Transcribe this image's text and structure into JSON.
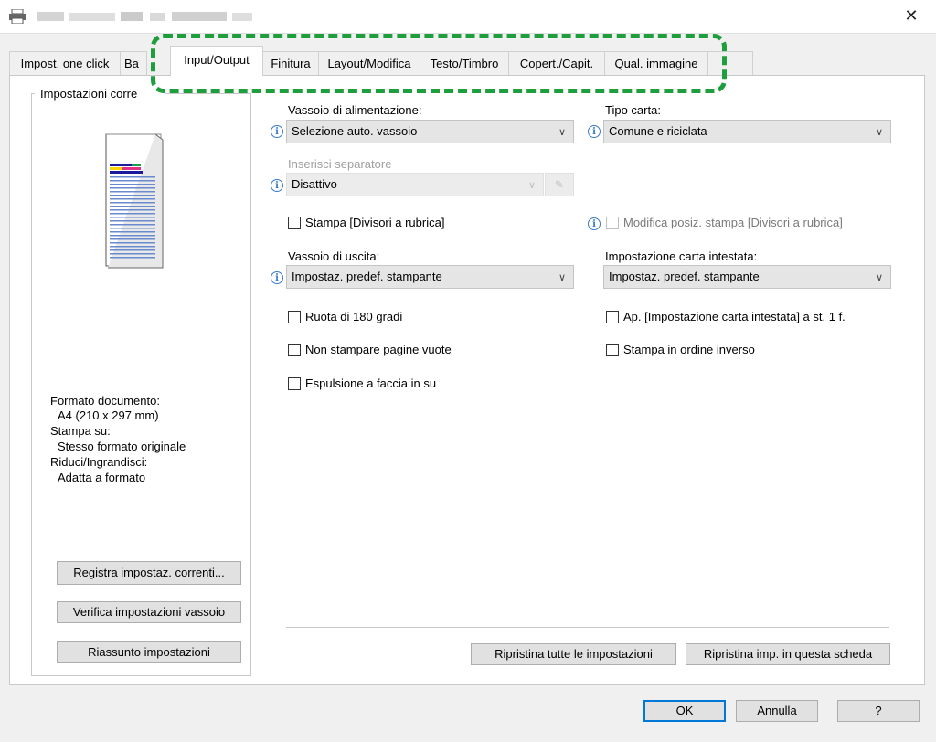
{
  "window": {
    "close_glyph": "✕"
  },
  "tabs": [
    {
      "label": "Impost. one click"
    },
    {
      "label": "Ba"
    },
    {
      "label": "Input/Output"
    },
    {
      "label": "Finitura"
    },
    {
      "label": "Layout/Modifica"
    },
    {
      "label": "Testo/Timbro"
    },
    {
      "label": "Copert./Capit."
    },
    {
      "label": "Qual. immagine"
    }
  ],
  "left_panel": {
    "group_title": "Impostazioni corre",
    "doc_format_label": "Formato documento:",
    "doc_format_value": "A4 (210 x 297 mm)",
    "print_on_label": "Stampa su:",
    "print_on_value": "Stesso formato originale",
    "scale_label": "Riduci/Ingrandisci:",
    "scale_value": "Adatta a formato",
    "btn_register": "Registra impostaz. correnti...",
    "btn_verify": "Verifica impostazioni vassoio",
    "btn_summary": "Riassunto impostazioni"
  },
  "main": {
    "input_tray_label": "Vassoio di alimentazione:",
    "input_tray_value": "Selezione auto. vassoio",
    "paper_type_label": "Tipo carta:",
    "paper_type_value": "Comune e riciclata",
    "separator_label": "Inserisci separatore",
    "separator_value": "Disattivo",
    "print_tabs_label": "Stampa [Divisori a rubrica]",
    "modify_pos_label": "Modifica posiz. stampa [Divisori a rubrica]",
    "output_tray_label": "Vassoio di uscita:",
    "output_tray_value": "Impostaz. predef. stampante",
    "letterhead_label": "Impostazione carta intestata:",
    "letterhead_value": "Impostaz. predef. stampante",
    "rotate_label": "Ruota di 180 gradi",
    "letterhead_first_label": "Ap. [Impostazione carta intestata] a st. 1 f.",
    "no_blank_label": "Non stampare pagine vuote",
    "reverse_label": "Stampa in ordine inverso",
    "face_up_label": "Espulsione a faccia in su",
    "btn_reset_all": "Ripristina tutte le impostazioni",
    "btn_reset_tab": "Ripristina imp. in questa scheda"
  },
  "footer": {
    "ok": "OK",
    "cancel": "Annulla",
    "help": "?"
  },
  "colors": {
    "highlight": "#1e9e3c",
    "info_icon": "#3a7bc8"
  }
}
